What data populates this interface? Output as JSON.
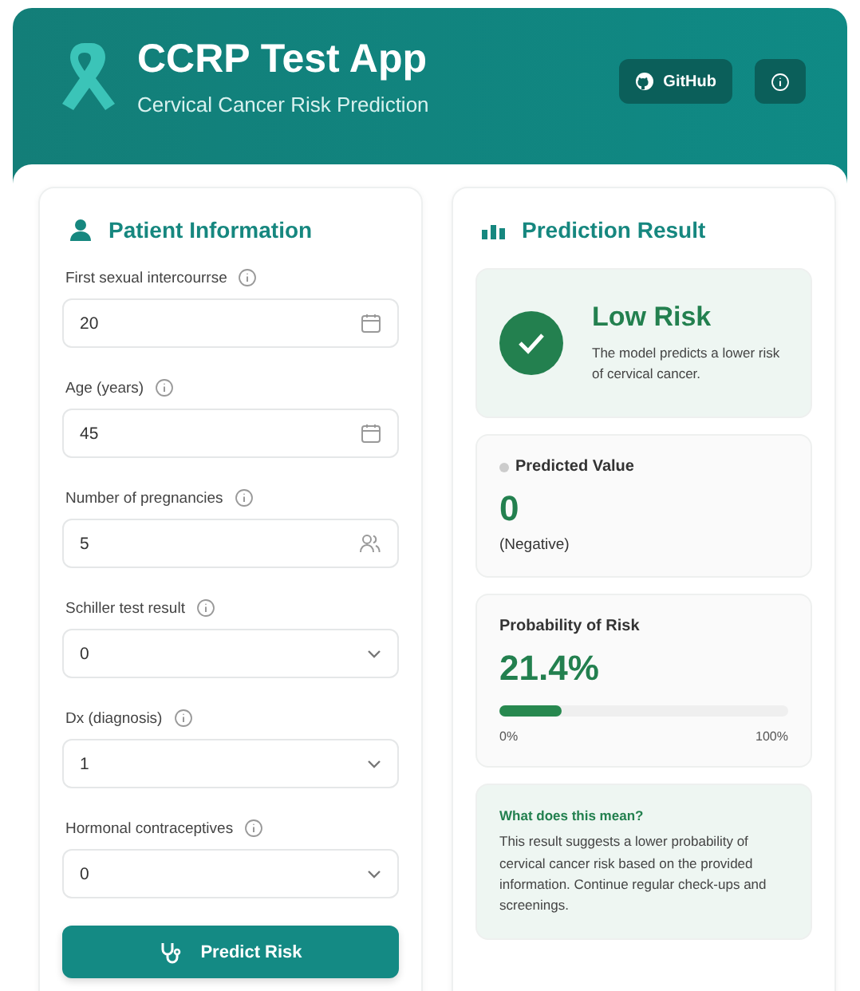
{
  "header": {
    "title": "CCRP Test App",
    "subtitle": "Cervical Cancer Risk Prediction",
    "github_label": "GitHub"
  },
  "patient": {
    "title": "Patient Information",
    "fields": [
      {
        "label": "First sexual intercourrse",
        "kind": "date",
        "value": "20"
      },
      {
        "label": "Age (years)",
        "kind": "date",
        "value": "45"
      },
      {
        "label": "Number of pregnancies",
        "kind": "count",
        "value": "5"
      },
      {
        "label": "Schiller test result",
        "kind": "select",
        "value": "0"
      },
      {
        "label": "Dx (diagnosis)",
        "kind": "select",
        "value": "1"
      },
      {
        "label": "Hormonal contraceptives",
        "kind": "select",
        "value": "0"
      }
    ],
    "submit": "Predict Risk"
  },
  "result": {
    "title": "Prediction Result",
    "verdict": {
      "title": "Low Risk",
      "text": "The model predicts a lower risk of cervical cancer."
    },
    "predicted": {
      "label": "Predicted Value",
      "value": "0",
      "note": "(Negative)"
    },
    "probability": {
      "label": "Probability of Risk",
      "value": "21.4%",
      "level": 0.214,
      "min": "0%",
      "max": "100%"
    },
    "explanation": {
      "title": "What does this mean?",
      "text": "This result suggests a lower probability of cervical cancer risk based on the provided information. Continue regular check-ups and screenings."
    }
  }
}
